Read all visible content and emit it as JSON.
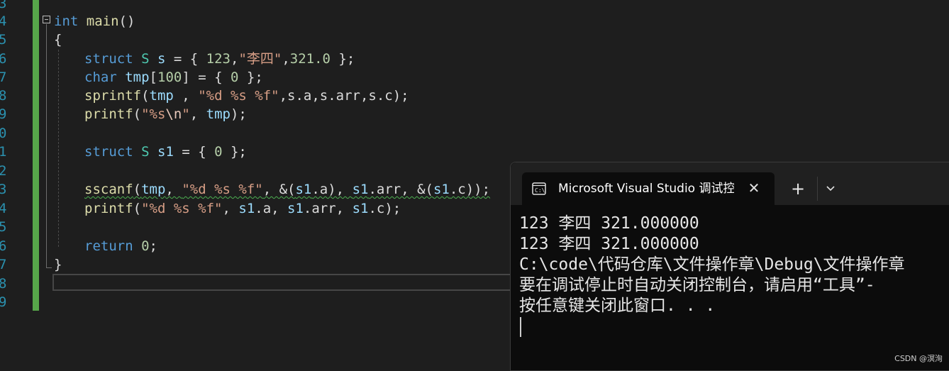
{
  "editor": {
    "line_numbers": [
      "3",
      "4",
      "5",
      "6",
      "7",
      "8",
      "9",
      "0",
      "1",
      "2",
      "3",
      "4",
      "5",
      "6",
      "7",
      "8",
      "9"
    ],
    "lines": {
      "l4": {
        "int": "int",
        "main": "main",
        "rest": "()"
      },
      "l5": {
        "brace": "{"
      },
      "l6": {
        "struct": "struct",
        "S": "S",
        "s": "s",
        "eq": " = { ",
        "n1": "123",
        ",": ",",
        "str": "\"李四\"",
        "c2": ",",
        "n2": "321.0",
        "end": " };"
      },
      "l7": {
        "char": "char",
        "tmp": "tmp",
        "lb": "[",
        "n": "100",
        "rb": "]",
        "eq": " = { ",
        "z": "0",
        "end": " };"
      },
      "l8": {
        "fn": "sprintf",
        "lp": "(",
        "tmp": "tmp",
        "sep": " , ",
        "str": "\"%d %s %f\"",
        "rest": ",s.a,s.arr,s.c);"
      },
      "l9": {
        "fn": "printf",
        "lp": "(",
        "str1": "\"%s",
        "esc": "\\n",
        "str2": "\"",
        "sep": ", ",
        "tmp": "tmp",
        "end": ");"
      },
      "l11": {
        "struct": "struct",
        "S": "S",
        "s1": "s1",
        "eq": " = { ",
        "z": "0",
        "end": " };"
      },
      "l13": {
        "fn": "sscanf",
        "lp": "(",
        "tmp": "tmp",
        "sep": ", ",
        "str": "\"%d %s %f\"",
        "a1": ", &(",
        "s1a": "s1",
        "a2": ".a), ",
        "s1b": "s1",
        "a3": ".arr, &(",
        "s1c": "s1",
        "a4": ".c));"
      },
      "l14": {
        "fn": "printf",
        "lp": "(",
        "str": "\"%d %s %f\"",
        "a1": ", ",
        "s1a": "s1",
        "a2": ".a, ",
        "s1b": "s1",
        "a3": ".arr, ",
        "s1c": "s1",
        "a4": ".c);"
      },
      "l16": {
        "ret": "return",
        "z": "0",
        ";": ";"
      },
      "l17": {
        "brace": "}"
      }
    }
  },
  "terminal": {
    "tab_title": "Microsoft Visual Studio 调试控制台",
    "close_glyph": "✕",
    "plus_glyph": "+",
    "output": [
      "123 李四 321.000000",
      "123 李四 321.000000",
      "C:\\code\\代码仓库\\文件操作章\\Debug\\文件操作章",
      "要在调试停止时自动关闭控制台，请启用“工具”-",
      "按任意键关闭此窗口. . ."
    ]
  },
  "watermark": "CSDN @溟洵",
  "colors": {
    "keyword": "#569cd6",
    "type": "#4ec9b0",
    "function": "#dcdcaa",
    "variable": "#9cdcfe",
    "string": "#d69d85",
    "number": "#b5cea8",
    "line_number": "#2b91af"
  }
}
